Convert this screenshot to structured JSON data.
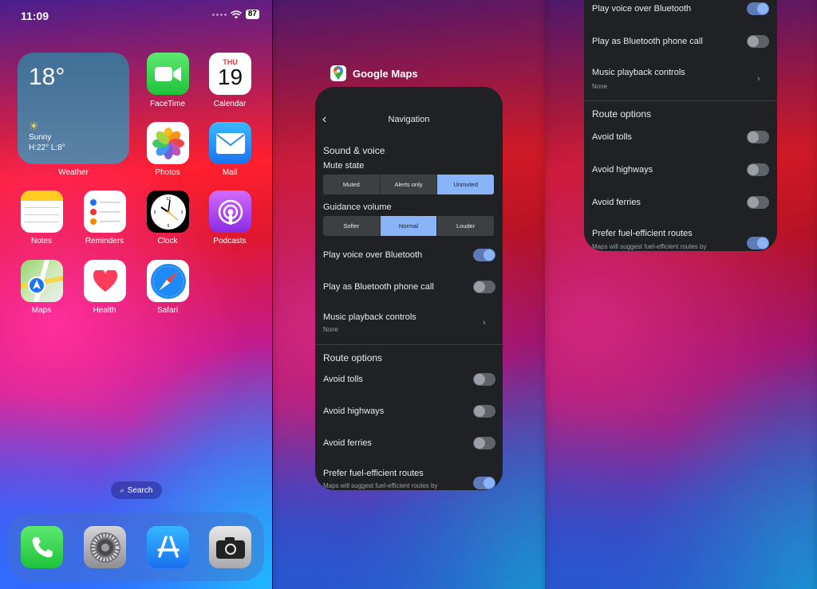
{
  "home": {
    "status": {
      "time": "11:09",
      "battery": "87"
    },
    "weather": {
      "temp": "18°",
      "condition": "Sunny",
      "high_low": "H:22° L:8°",
      "label": "Weather"
    },
    "apps": [
      {
        "label": "FaceTime"
      },
      {
        "label": "Calendar",
        "day": "THU",
        "date": "19"
      },
      {
        "label": "Photos"
      },
      {
        "label": "Mail"
      },
      {
        "label": "Notes"
      },
      {
        "label": "Reminders"
      },
      {
        "label": "Clock"
      },
      {
        "label": "Podcasts"
      },
      {
        "label": "Maps"
      },
      {
        "label": "Health"
      },
      {
        "label": "Safari"
      }
    ],
    "search_label": "Search"
  },
  "switcher": {
    "app_name": "Google Maps",
    "settings": {
      "title": "Navigation",
      "sound_voice": "Sound & voice",
      "mute_state": {
        "label": "Mute state",
        "options": [
          "Muted",
          "Alerts only",
          "Unmuted"
        ],
        "selected": "Unmuted"
      },
      "guidance_volume": {
        "label": "Guidance volume",
        "options": [
          "Softer",
          "Normal",
          "Louder"
        ],
        "selected": "Normal"
      },
      "play_bluetooth": "Play voice over Bluetooth",
      "play_phone_call": "Play as Bluetooth phone call",
      "music_controls": "Music playback controls",
      "music_value": "None",
      "route_options": "Route options",
      "avoid_tolls": "Avoid tolls",
      "avoid_highways": "Avoid highways",
      "avoid_ferries": "Avoid ferries",
      "prefer_fuel": "Prefer fuel-efficient routes",
      "prefer_fuel_sub": "Maps will suggest fuel-efficient routes by"
    }
  },
  "colors": {
    "accent": "#8ab4f8",
    "card_bg": "#202124"
  }
}
